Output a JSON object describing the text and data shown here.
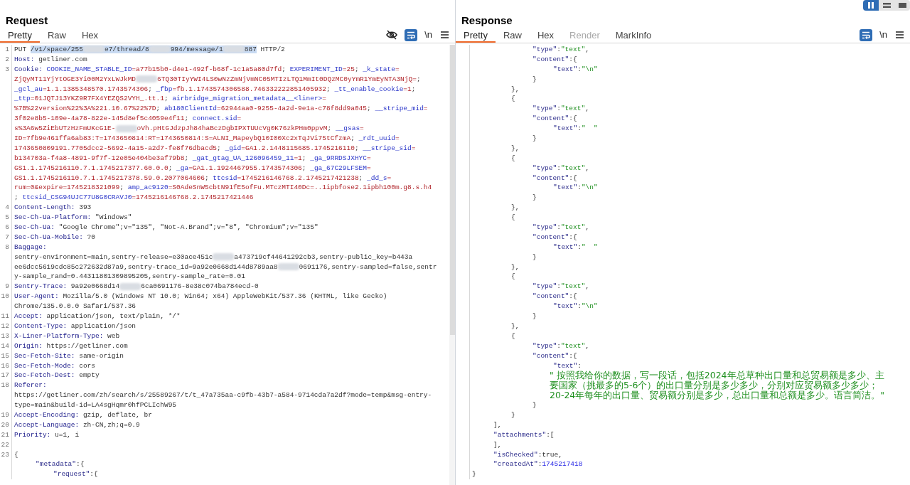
{
  "layout_toggles": [
    {
      "kind": "columns",
      "selected": true
    },
    {
      "kind": "rows",
      "selected": false
    },
    {
      "kind": "single",
      "selected": false
    }
  ],
  "request": {
    "title": "Request",
    "tabs": [
      {
        "label": "Pretty",
        "selected": true
      },
      {
        "label": "Raw",
        "selected": false
      },
      {
        "label": "Hex",
        "selected": false
      }
    ],
    "toolbar": [
      {
        "kind": "hide",
        "selected": false
      },
      {
        "kind": "wrap",
        "selected": true
      },
      {
        "kind": "newline",
        "label": "\\n"
      },
      {
        "kind": "menu"
      }
    ],
    "lines": [
      {
        "number": "1",
        "rows": [
          {
            "kind": "top",
            "segments": [
              {
                "kind": "plain",
                "text": "PUT "
              },
              {
                "kind": "selection",
                "parts": [
                  {
                    "kind": "plain",
                    "text": "/v1/space/255"
                  },
                  {
                    "kind": "redacted"
                  },
                  {
                    "kind": "plain",
                    "text": "e7/thread/8"
                  },
                  {
                    "kind": "redacted"
                  },
                  {
                    "kind": "plain",
                    "text": "994/message/1"
                  },
                  {
                    "kind": "redacted"
                  },
                  {
                    "kind": "plain",
                    "text": "887"
                  }
                ]
              },
              {
                "kind": "plain",
                "text": " HTTP/2"
              }
            ]
          }
        ]
      },
      {
        "number": "2",
        "rows": [
          {
            "kind": "top",
            "segments": [
              {
                "kind": "header",
                "text": "Host:"
              },
              {
                "kind": "plain",
                "text": " getliner.com"
              }
            ]
          }
        ]
      },
      {
        "number": "3",
        "rows": [
          {
            "kind": "top",
            "segments": [
              {
                "kind": "header",
                "text": "Cookie: "
              },
              {
                "kind": "ckey",
                "text": "COOKIE_NAME_STABLE_ID"
              },
              {
                "kind": "cval",
                "text": "=a77b15b0-d4e1-492f-b68f-1c1a5a80d7fd"
              },
              {
                "kind": "plain",
                "text": "; "
              },
              {
                "kind": "ckey",
                "text": "EXPERIMENT_ID"
              },
              {
                "kind": "cval",
                "text": "=25"
              },
              {
                "kind": "plain",
                "text": "; "
              },
              {
                "kind": "ckey",
                "text": "_k_state"
              },
              {
                "kind": "cval",
                "text": "="
              }
            ]
          },
          {
            "kind": "top",
            "segments": [
              {
                "kind": "cval",
                "text": "ZjQyMT11YjYtOGE3Yi00M2YxLWJkMD"
              },
              {
                "kind": "redacted"
              },
              {
                "kind": "cval",
                "text": "6TQ30TIyYWI4LS0wNzZmNjVmNC05MTIzLTQ1MmIt0DQzMC0yYmR1YmEyNTA3NjQ="
              },
              {
                "kind": "plain",
                "text": ";"
              }
            ]
          },
          {
            "kind": "top",
            "segments": [
              {
                "kind": "ckey",
                "text": "_gcl_au"
              },
              {
                "kind": "cval",
                "text": "=1.1.1385348570.1743574306"
              },
              {
                "kind": "plain",
                "text": "; "
              },
              {
                "kind": "ckey",
                "text": "_fbp"
              },
              {
                "kind": "cval",
                "text": "=fb.1.1743574306588.746332222851405932"
              },
              {
                "kind": "plain",
                "text": "; "
              },
              {
                "kind": "ckey",
                "text": "_tt_enable_cookie"
              },
              {
                "kind": "cval",
                "text": "=1"
              },
              {
                "kind": "plain",
                "text": ";"
              }
            ]
          },
          {
            "kind": "top",
            "segments": [
              {
                "kind": "ckey",
                "text": "_ttp"
              },
              {
                "kind": "cval",
                "text": "=01JQTJ13YKZ9R7FX4YEZQS2VYH_.tt.1"
              },
              {
                "kind": "plain",
                "text": "; "
              },
              {
                "kind": "ckey",
                "text": "airbridge_migration_metadata__<liner>"
              },
              {
                "kind": "cval",
                "text": "="
              }
            ]
          },
          {
            "kind": "top",
            "segments": [
              {
                "kind": "cval",
                "text": "%7B%22version%22%3A%221.10.67%22%7D"
              },
              {
                "kind": "plain",
                "text": "; "
              },
              {
                "kind": "ckey",
                "text": "ab180ClientId"
              },
              {
                "kind": "cval",
                "text": "=62944aa0-9255-4a2d-9e1a-c78f8dd9a045"
              },
              {
                "kind": "plain",
                "text": "; "
              },
              {
                "kind": "ckey",
                "text": "__stripe_mid"
              },
              {
                "kind": "cval",
                "text": "="
              }
            ]
          },
          {
            "kind": "top",
            "segments": [
              {
                "kind": "cval",
                "text": "3f02e8b5-109e-4a78-822e-145d8ef5c4059e4f11"
              },
              {
                "kind": "plain",
                "text": "; "
              },
              {
                "kind": "ckey",
                "text": "connect.sid"
              },
              {
                "kind": "cval",
                "text": "="
              }
            ]
          },
          {
            "kind": "top",
            "segments": [
              {
                "kind": "cval",
                "text": "s%3A6w5ZiEbUTzHzFmUKcG1E-"
              },
              {
                "kind": "redacted"
              },
              {
                "kind": "cval",
                "text": "oVh.pHtGJdzpJh84haBczDgbIPXTUUcVg0K76zkPHm0ppvM"
              },
              {
                "kind": "plain",
                "text": "; "
              },
              {
                "kind": "ckey",
                "text": "__gsas"
              },
              {
                "kind": "cval",
                "text": "="
              }
            ]
          },
          {
            "kind": "top",
            "segments": [
              {
                "kind": "cval",
                "text": "ID=7fb9e461ffa6ab83:T=1743650814:RT=1743650814:S=ALNI_MapeybQ10I00Xc2xTqJVi75tCfzmA"
              },
              {
                "kind": "plain",
                "text": "; "
              },
              {
                "kind": "ckey",
                "text": "_rdt_uuid"
              },
              {
                "kind": "cval",
                "text": "="
              }
            ]
          },
          {
            "kind": "top",
            "segments": [
              {
                "kind": "cval",
                "text": "1743650809191.7705dcc2-5692-4a15-a2d7-fe8f76dbacd5"
              },
              {
                "kind": "plain",
                "text": "; "
              },
              {
                "kind": "ckey",
                "text": "_gid"
              },
              {
                "kind": "cval",
                "text": "=GA1.2.1448115685.1745216110"
              },
              {
                "kind": "plain",
                "text": "; "
              },
              {
                "kind": "ckey",
                "text": "__stripe_sid"
              },
              {
                "kind": "cval",
                "text": "="
              }
            ]
          },
          {
            "kind": "top",
            "segments": [
              {
                "kind": "cval",
                "text": "b134703a-f4a8-4891-9f7f-12e05e404be3af79b8"
              },
              {
                "kind": "plain",
                "text": "; "
              },
              {
                "kind": "ckey",
                "text": "_gat_gtag_UA_126096459_11"
              },
              {
                "kind": "cval",
                "text": "=1"
              },
              {
                "kind": "plain",
                "text": "; "
              },
              {
                "kind": "ckey",
                "text": "_ga_9RRDSJXHYC"
              },
              {
                "kind": "cval",
                "text": "="
              }
            ]
          },
          {
            "kind": "top",
            "segments": [
              {
                "kind": "cval",
                "text": "GS1.1.1745216110.7.1.1745217377.60.0.0"
              },
              {
                "kind": "plain",
                "text": "; "
              },
              {
                "kind": "ckey",
                "text": "_ga"
              },
              {
                "kind": "cval",
                "text": "=GA1.1.1924467955.1743574306"
              },
              {
                "kind": "plain",
                "text": "; "
              },
              {
                "kind": "ckey",
                "text": "_ga_67C29LFSEM"
              },
              {
                "kind": "cval",
                "text": "="
              }
            ]
          },
          {
            "kind": "top",
            "segments": [
              {
                "kind": "cval",
                "text": "GS1.1.1745216110.7.1.1745217378.59.0.2077064606"
              },
              {
                "kind": "plain",
                "text": "; "
              },
              {
                "kind": "ckey",
                "text": "ttcsid"
              },
              {
                "kind": "cval",
                "text": "=1745216146768.2.1745217421238"
              },
              {
                "kind": "plain",
                "text": "; "
              },
              {
                "kind": "ckey",
                "text": "_dd_s"
              },
              {
                "kind": "cval",
                "text": "="
              }
            ]
          },
          {
            "kind": "top",
            "segments": [
              {
                "kind": "cval",
                "text": "rum=0&expire=1745218321099"
              },
              {
                "kind": "plain",
                "text": "; "
              },
              {
                "kind": "ckey",
                "text": "amp_ac9120"
              },
              {
                "kind": "cval",
                "text": "=S0AdeSnW5cbtN91fE5ofFu.MTczMTI40Dc=..1ipbfose2.1ipbh100m.g8.s.h4"
              }
            ]
          },
          {
            "kind": "top",
            "segments": [
              {
                "kind": "plain",
                "text": "; "
              },
              {
                "kind": "ckey",
                "text": "ttcsid_CSG94UJC77U8G0CRAVJ0"
              },
              {
                "kind": "cval",
                "text": "=1745216146768.2.1745217421446"
              }
            ]
          }
        ]
      },
      {
        "number": "4",
        "rows": [
          {
            "kind": "top",
            "segments": [
              {
                "kind": "header",
                "text": "Content-Length:"
              },
              {
                "kind": "plain",
                "text": " 393"
              }
            ]
          }
        ]
      },
      {
        "number": "5",
        "rows": [
          {
            "kind": "top",
            "segments": [
              {
                "kind": "header",
                "text": "Sec-Ch-Ua-Platform:"
              },
              {
                "kind": "plain",
                "text": " \"Windows\""
              }
            ]
          }
        ]
      },
      {
        "number": "6",
        "rows": [
          {
            "kind": "top",
            "segments": [
              {
                "kind": "header",
                "text": "Sec-Ch-Ua:"
              },
              {
                "kind": "plain",
                "text": " \"Google Chrome\";v=\"135\", \"Not-A.Brand\";v=\"8\", \"Chromium\";v=\"135\""
              }
            ]
          }
        ]
      },
      {
        "number": "7",
        "rows": [
          {
            "kind": "top",
            "segments": [
              {
                "kind": "header",
                "text": "Sec-Ch-Ua-Mobile:"
              },
              {
                "kind": "plain",
                "text": " ?0"
              }
            ]
          }
        ]
      },
      {
        "number": "8",
        "rows": [
          {
            "kind": "top",
            "segments": [
              {
                "kind": "header",
                "text": "Baggage:"
              }
            ]
          },
          {
            "kind": "top",
            "segments": [
              {
                "kind": "plain",
                "text": "sentry-environment=main,sentry-release=e30ace451c"
              },
              {
                "kind": "redacted"
              },
              {
                "kind": "plain",
                "text": "a473719cf44641292cb3,sentry-public_key=b443a"
              }
            ]
          },
          {
            "kind": "top",
            "segments": [
              {
                "kind": "plain",
                "text": "ee6dcc5619cdc85c272632d87a9,sentry-trace_id=9a92e0668d144d8789aa8"
              },
              {
                "kind": "redacted"
              },
              {
                "kind": "plain",
                "text": "0691176,sentry-sampled=false,sentr"
              }
            ]
          },
          {
            "kind": "top",
            "segments": [
              {
                "kind": "plain",
                "text": "y-sample_rand=0.44311801309895205,sentry-sample_rate=0.01"
              }
            ]
          }
        ]
      },
      {
        "number": "9",
        "rows": [
          {
            "kind": "top",
            "segments": [
              {
                "kind": "header",
                "text": "Sentry-Trace:"
              },
              {
                "kind": "plain",
                "text": " 9a92e0668d14"
              },
              {
                "kind": "redacted"
              },
              {
                "kind": "plain",
                "text": "6ca0691176-8e38c074ba784ecd-0"
              }
            ]
          }
        ]
      },
      {
        "number": "10",
        "rows": [
          {
            "kind": "top",
            "segments": [
              {
                "kind": "header",
                "text": "User-Agent:"
              },
              {
                "kind": "plain",
                "text": " Mozilla/5.0 (Windows NT 10.0; Win64; x64) AppleWebKit/537.36 (KHTML, like Gecko)"
              }
            ]
          },
          {
            "kind": "top",
            "segments": [
              {
                "kind": "plain",
                "text": "Chrome/135.0.0.0 Safari/537.36"
              }
            ]
          }
        ]
      },
      {
        "number": "11",
        "rows": [
          {
            "kind": "top",
            "segments": [
              {
                "kind": "header",
                "text": "Accept:"
              },
              {
                "kind": "plain",
                "text": " application/json, text/plain, */*"
              }
            ]
          }
        ]
      },
      {
        "number": "12",
        "rows": [
          {
            "kind": "top",
            "segments": [
              {
                "kind": "header",
                "text": "Content-Type:"
              },
              {
                "kind": "plain",
                "text": " application/json"
              }
            ]
          }
        ]
      },
      {
        "number": "13",
        "rows": [
          {
            "kind": "top",
            "segments": [
              {
                "kind": "header",
                "text": "X-Liner-Platform-Type:"
              },
              {
                "kind": "plain",
                "text": " web"
              }
            ]
          }
        ]
      },
      {
        "number": "14",
        "rows": [
          {
            "kind": "top",
            "segments": [
              {
                "kind": "header",
                "text": "Origin:"
              },
              {
                "kind": "plain",
                "text": " https://getliner.com"
              }
            ]
          }
        ]
      },
      {
        "number": "15",
        "rows": [
          {
            "kind": "top",
            "segments": [
              {
                "kind": "header",
                "text": "Sec-Fetch-Site:"
              },
              {
                "kind": "plain",
                "text": " same-origin"
              }
            ]
          }
        ]
      },
      {
        "number": "16",
        "rows": [
          {
            "kind": "top",
            "segments": [
              {
                "kind": "header",
                "text": "Sec-Fetch-Mode:"
              },
              {
                "kind": "plain",
                "text": " cors"
              }
            ]
          }
        ]
      },
      {
        "number": "17",
        "rows": [
          {
            "kind": "top",
            "segments": [
              {
                "kind": "header",
                "text": "Sec-Fetch-Dest:"
              },
              {
                "kind": "plain",
                "text": " empty"
              }
            ]
          }
        ]
      },
      {
        "number": "18",
        "rows": [
          {
            "kind": "top",
            "segments": [
              {
                "kind": "header",
                "text": "Referer:"
              }
            ]
          },
          {
            "kind": "top",
            "segments": [
              {
                "kind": "plain",
                "text": "https://getliner.com/zh/search/s/25589267/t/t_47a735aa-c9fb-43b7-a584-9714cda7a2df?mode=temp&msg-entry-"
              }
            ]
          },
          {
            "kind": "top",
            "segments": [
              {
                "kind": "plain",
                "text": "type=main&build-id=LA4sgHqmr0hfPCLIchW95"
              }
            ]
          }
        ]
      },
      {
        "number": "19",
        "rows": [
          {
            "kind": "top",
            "segments": [
              {
                "kind": "header",
                "text": "Accept-Encoding:"
              },
              {
                "kind": "plain",
                "text": " gzip, deflate, br"
              }
            ]
          }
        ]
      },
      {
        "number": "20",
        "rows": [
          {
            "kind": "top",
            "segments": [
              {
                "kind": "header",
                "text": "Accept-Language:"
              },
              {
                "kind": "plain",
                "text": " zh-CN,zh;q=0.9"
              }
            ]
          }
        ]
      },
      {
        "number": "21",
        "rows": [
          {
            "kind": "top",
            "segments": [
              {
                "kind": "header",
                "text": "Priority:"
              },
              {
                "kind": "plain",
                "text": " u=1, i"
              }
            ]
          }
        ]
      },
      {
        "number": "22",
        "rows": [
          {
            "kind": "top"
          }
        ]
      },
      {
        "number": "23",
        "rows": [
          {
            "kind": "top",
            "segments": [
              {
                "kind": "plain",
                "text": "{"
              }
            ]
          },
          {
            "kind": "member",
            "segments": [
              {
                "kind": "jkey",
                "text": "\"metadata\""
              },
              {
                "kind": "plain",
                "text": ":{"
              }
            ]
          },
          {
            "kind": "item",
            "segments": [
              {
                "kind": "jkey",
                "text": "\"request\""
              },
              {
                "kind": "plain",
                "text": ":{"
              }
            ]
          }
        ]
      }
    ]
  },
  "response": {
    "title": "Response",
    "tabs": [
      {
        "label": "Pretty",
        "selected": true,
        "disabled": false
      },
      {
        "label": "Raw",
        "selected": false,
        "disabled": false
      },
      {
        "label": "Hex",
        "selected": false,
        "disabled": false
      },
      {
        "label": "Render",
        "selected": false,
        "disabled": true
      },
      {
        "label": "MarkInfo",
        "selected": false,
        "disabled": false
      }
    ],
    "toolbar": [
      {
        "kind": "wrap",
        "selected": true
      },
      {
        "kind": "newline",
        "label": "\\n"
      },
      {
        "kind": "menu"
      }
    ],
    "rows": [
      {
        "kind": "field",
        "segments": [
          {
            "kind": "jkey",
            "text": "\"type\""
          },
          {
            "kind": "plain",
            "text": ":"
          },
          {
            "kind": "str",
            "text": "\"text\""
          },
          {
            "kind": "plain",
            "text": ","
          }
        ]
      },
      {
        "kind": "field",
        "segments": [
          {
            "kind": "jkey",
            "text": "\"content\""
          },
          {
            "kind": "plain",
            "text": ":{"
          }
        ]
      },
      {
        "kind": "value",
        "segments": [
          {
            "kind": "jkey",
            "text": "\"text\""
          },
          {
            "kind": "plain",
            "text": ":"
          },
          {
            "kind": "str",
            "text": "\"\\n\""
          }
        ]
      },
      {
        "kind": "field",
        "segments": [
          {
            "kind": "plain",
            "text": "}"
          }
        ]
      },
      {
        "kind": "item",
        "segments": [
          {
            "kind": "plain",
            "text": "},"
          }
        ]
      },
      {
        "kind": "item",
        "segments": [
          {
            "kind": "plain",
            "text": "{"
          }
        ]
      },
      {
        "kind": "field",
        "segments": [
          {
            "kind": "jkey",
            "text": "\"type\""
          },
          {
            "kind": "plain",
            "text": ":"
          },
          {
            "kind": "str",
            "text": "\"text\""
          },
          {
            "kind": "plain",
            "text": ","
          }
        ]
      },
      {
        "kind": "field",
        "segments": [
          {
            "kind": "jkey",
            "text": "\"content\""
          },
          {
            "kind": "plain",
            "text": ":{"
          }
        ]
      },
      {
        "kind": "value",
        "segments": [
          {
            "kind": "jkey",
            "text": "\"text\""
          },
          {
            "kind": "plain",
            "text": ":"
          },
          {
            "kind": "str",
            "text": "\"  \""
          }
        ]
      },
      {
        "kind": "field",
        "segments": [
          {
            "kind": "plain",
            "text": "}"
          }
        ]
      },
      {
        "kind": "item",
        "segments": [
          {
            "kind": "plain",
            "text": "},"
          }
        ]
      },
      {
        "kind": "item",
        "segments": [
          {
            "kind": "plain",
            "text": "{"
          }
        ]
      },
      {
        "kind": "field",
        "segments": [
          {
            "kind": "jkey",
            "text": "\"type\""
          },
          {
            "kind": "plain",
            "text": ":"
          },
          {
            "kind": "str",
            "text": "\"text\""
          },
          {
            "kind": "plain",
            "text": ","
          }
        ]
      },
      {
        "kind": "field",
        "segments": [
          {
            "kind": "jkey",
            "text": "\"content\""
          },
          {
            "kind": "plain",
            "text": ":{"
          }
        ]
      },
      {
        "kind": "value",
        "segments": [
          {
            "kind": "jkey",
            "text": "\"text\""
          },
          {
            "kind": "plain",
            "text": ":"
          },
          {
            "kind": "str",
            "text": "\"\\n\""
          }
        ]
      },
      {
        "kind": "field",
        "segments": [
          {
            "kind": "plain",
            "text": "}"
          }
        ]
      },
      {
        "kind": "item",
        "segments": [
          {
            "kind": "plain",
            "text": "},"
          }
        ]
      },
      {
        "kind": "item",
        "segments": [
          {
            "kind": "plain",
            "text": "{"
          }
        ]
      },
      {
        "kind": "field",
        "segments": [
          {
            "kind": "jkey",
            "text": "\"type\""
          },
          {
            "kind": "plain",
            "text": ":"
          },
          {
            "kind": "str",
            "text": "\"text\""
          },
          {
            "kind": "plain",
            "text": ","
          }
        ]
      },
      {
        "kind": "field",
        "segments": [
          {
            "kind": "jkey",
            "text": "\"content\""
          },
          {
            "kind": "plain",
            "text": ":{"
          }
        ]
      },
      {
        "kind": "value",
        "segments": [
          {
            "kind": "jkey",
            "text": "\"text\""
          },
          {
            "kind": "plain",
            "text": ":"
          },
          {
            "kind": "str",
            "text": "\"  \""
          }
        ]
      },
      {
        "kind": "field",
        "segments": [
          {
            "kind": "plain",
            "text": "}"
          }
        ]
      },
      {
        "kind": "item",
        "segments": [
          {
            "kind": "plain",
            "text": "},"
          }
        ]
      },
      {
        "kind": "item",
        "segments": [
          {
            "kind": "plain",
            "text": "{"
          }
        ]
      },
      {
        "kind": "field",
        "segments": [
          {
            "kind": "jkey",
            "text": "\"type\""
          },
          {
            "kind": "plain",
            "text": ":"
          },
          {
            "kind": "str",
            "text": "\"text\""
          },
          {
            "kind": "plain",
            "text": ","
          }
        ]
      },
      {
        "kind": "field",
        "segments": [
          {
            "kind": "jkey",
            "text": "\"content\""
          },
          {
            "kind": "plain",
            "text": ":{"
          }
        ]
      },
      {
        "kind": "value",
        "segments": [
          {
            "kind": "jkey",
            "text": "\"text\""
          },
          {
            "kind": "plain",
            "text": ":"
          },
          {
            "kind": "str",
            "text": "\"\\n\""
          }
        ]
      },
      {
        "kind": "field",
        "segments": [
          {
            "kind": "plain",
            "text": "}"
          }
        ]
      },
      {
        "kind": "item",
        "segments": [
          {
            "kind": "plain",
            "text": "},"
          }
        ]
      },
      {
        "kind": "item",
        "segments": [
          {
            "kind": "plain",
            "text": "{"
          }
        ]
      },
      {
        "kind": "field",
        "segments": [
          {
            "kind": "jkey",
            "text": "\"type\""
          },
          {
            "kind": "plain",
            "text": ":"
          },
          {
            "kind": "str",
            "text": "\"text\""
          },
          {
            "kind": "plain",
            "text": ","
          }
        ]
      },
      {
        "kind": "field",
        "segments": [
          {
            "kind": "jkey",
            "text": "\"content\""
          },
          {
            "kind": "plain",
            "text": ":{"
          }
        ]
      },
      {
        "kind": "value",
        "segments": [
          {
            "kind": "jkey",
            "text": "\"text\""
          },
          {
            "kind": "plain",
            "text": ":"
          }
        ]
      },
      {
        "kind": "block",
        "text": "\" 按照我给你的数据，写一段话，包括2024年总草种出口量和总贸易额是多少、主要国家（挑最多的5-6个）的出口量分别是多少多少，分别对应贸易额多少多少；20-24年每年的出口量、贸易额分别是多少，总出口量和总额是多少。语言简洁。\""
      },
      {
        "kind": "field",
        "segments": [
          {
            "kind": "plain",
            "text": "}"
          }
        ]
      },
      {
        "kind": "item",
        "segments": [
          {
            "kind": "plain",
            "text": "}"
          }
        ]
      },
      {
        "kind": "member",
        "segments": [
          {
            "kind": "plain",
            "text": "],"
          }
        ]
      },
      {
        "kind": "member",
        "segments": [
          {
            "kind": "jkey",
            "text": "\"attachments\""
          },
          {
            "kind": "plain",
            "text": ":["
          }
        ]
      },
      {
        "kind": "member",
        "segments": [
          {
            "kind": "plain",
            "text": "],"
          }
        ]
      },
      {
        "kind": "member",
        "segments": [
          {
            "kind": "jkey",
            "text": "\"isChecked\""
          },
          {
            "kind": "plain",
            "text": ":true,"
          }
        ]
      },
      {
        "kind": "member",
        "segments": [
          {
            "kind": "jkey",
            "text": "\"createdAt\""
          },
          {
            "kind": "plain",
            "text": ":"
          },
          {
            "kind": "num",
            "text": "1745217418"
          }
        ]
      },
      {
        "kind": "top",
        "segments": [
          {
            "kind": "plain",
            "text": "}"
          }
        ]
      }
    ]
  }
}
